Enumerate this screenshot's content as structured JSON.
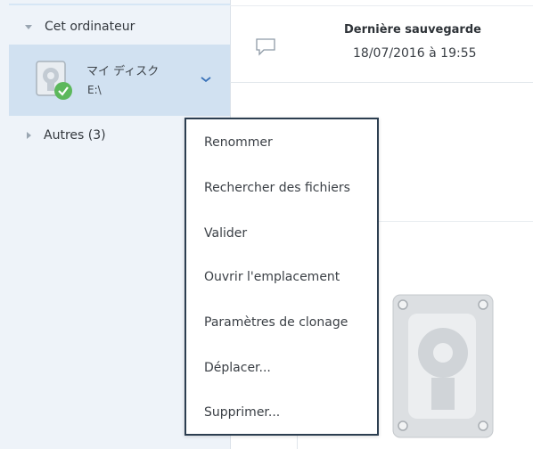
{
  "sidebar": {
    "group_label": "Cet ordinateur",
    "disk": {
      "name": "マイ ディスク",
      "path": "E:\\"
    },
    "others_label": "Autres (3)"
  },
  "backup": {
    "title": "Dernière sauvegarde",
    "date": "18/07/2016 à 19:55"
  },
  "context_menu": {
    "items": [
      "Renommer",
      "Rechercher des fichiers",
      "Valider",
      "Ouvrir l'emplacement",
      "Paramètres de clonage",
      "Déplacer...",
      "Supprimer..."
    ]
  },
  "colors": {
    "sidebar_bg": "#eef3f9",
    "selected_bg": "#d1e1f1",
    "status_green": "#5cb85c",
    "menu_border": "#2c3e50"
  }
}
